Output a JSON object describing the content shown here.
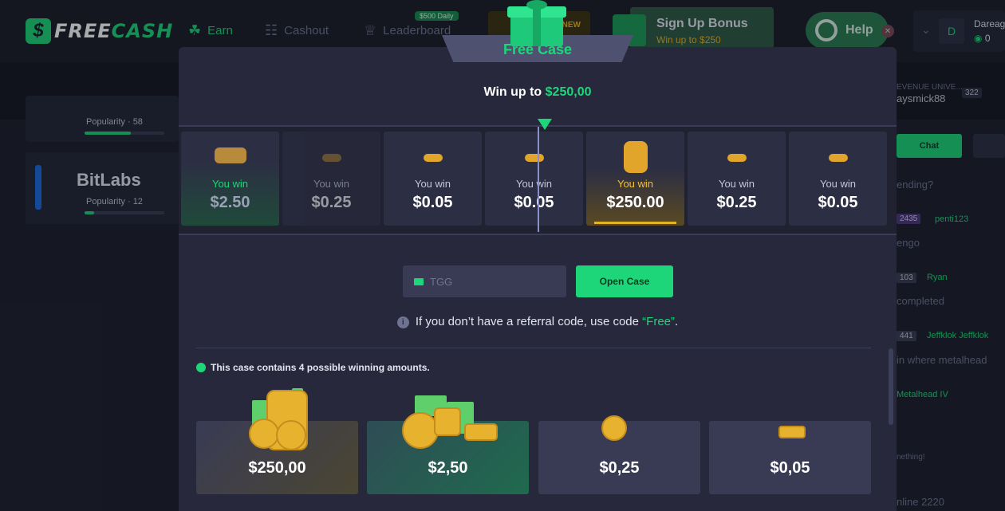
{
  "header": {
    "logo_text_a": "FREE",
    "logo_text_b": "CASH",
    "nav": [
      {
        "label": "Earn"
      },
      {
        "label": "Cashout"
      },
      {
        "label": "Leaderboard"
      }
    ],
    "daily_badge": "$500 Daily",
    "promo_badge": "NEW",
    "signup_title": "Sign Up Bonus",
    "signup_sub": "Win up to $250",
    "help_label": "Help",
    "user_name": "Dareag",
    "user_balance": "0",
    "user_avatar": "D"
  },
  "left": {
    "card1_popularity": "Popularity · 58",
    "card2_brand": "BitLabs",
    "card2_popularity": "Popularity · 12"
  },
  "chat": {
    "banner": "EVENUE UNIVE...",
    "banner_user": "aysmick88",
    "banner_count": "322",
    "tab_label": "Chat",
    "lines": [
      {
        "text": "ending?"
      },
      {
        "text": "engo"
      },
      {
        "text": "completed"
      },
      {
        "text": "in where metalhead"
      },
      {
        "text": "Metalhead IV"
      },
      {
        "text": "nething!"
      },
      {
        "text": "nline 2220"
      }
    ],
    "users": [
      {
        "level": "2435",
        "name": "penti123"
      },
      {
        "level": "103",
        "name": "Ryan"
      },
      {
        "level": "441",
        "name": "Jeffklok Jeffklok"
      }
    ]
  },
  "modal": {
    "title": "Free Case",
    "win_prefix": "Win up to",
    "win_amount": "$250,00",
    "strip": [
      {
        "label": "You win",
        "amount": "$2.50"
      },
      {
        "label": "You win",
        "amount": "$0.25"
      },
      {
        "label": "You win",
        "amount": "$0.05"
      },
      {
        "label": "You win",
        "amount": "$0.05"
      },
      {
        "label": "You win",
        "amount": "$250.00"
      },
      {
        "label": "You win",
        "amount": "$0.25"
      },
      {
        "label": "You win",
        "amount": "$0.05"
      }
    ],
    "code_value": "TGG",
    "open_label": "Open Case",
    "info_prefix": "If you don’t have a referral code, use code",
    "info_code": "“Free”",
    "info_suffix": ".",
    "contains_text": "This case contains 4 possible winning amounts.",
    "prizes": [
      {
        "amount": "$250,00"
      },
      {
        "amount": "$2,50"
      },
      {
        "amount": "$0,25"
      },
      {
        "amount": "$0,05"
      }
    ]
  }
}
